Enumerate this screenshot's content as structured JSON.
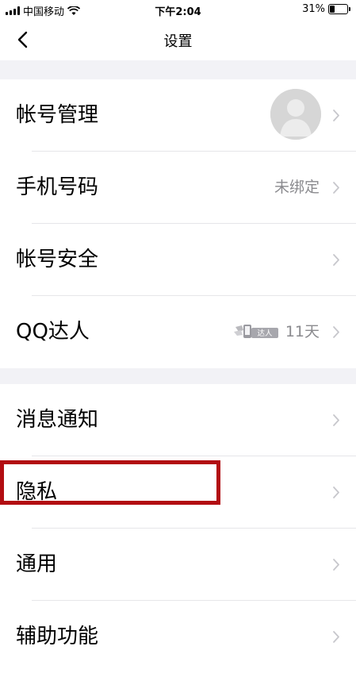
{
  "status_bar": {
    "carrier": "中国移动",
    "time": "下午2:04",
    "battery_text": "31%",
    "battery_level": 0.31
  },
  "nav": {
    "title": "设置",
    "back_icon": "chevron-left-icon"
  },
  "sections": [
    {
      "rows": [
        {
          "label": "帐号管理",
          "value": "",
          "accessory": "avatar"
        },
        {
          "label": "手机号码",
          "value": "未绑定"
        },
        {
          "label": "帐号安全",
          "value": ""
        },
        {
          "label": "QQ达人",
          "value": "11天",
          "badge_text": "达人"
        }
      ]
    },
    {
      "rows": [
        {
          "label": "消息通知",
          "value": ""
        },
        {
          "label": "隐私",
          "value": ""
        },
        {
          "label": "通用",
          "value": ""
        },
        {
          "label": "辅助功能",
          "value": ""
        }
      ]
    }
  ],
  "colors": {
    "background_gap": "#f2f2f6",
    "secondary_text": "#8a8a8e",
    "chevron": "#c7c7cc",
    "highlight": "#b20d12"
  }
}
